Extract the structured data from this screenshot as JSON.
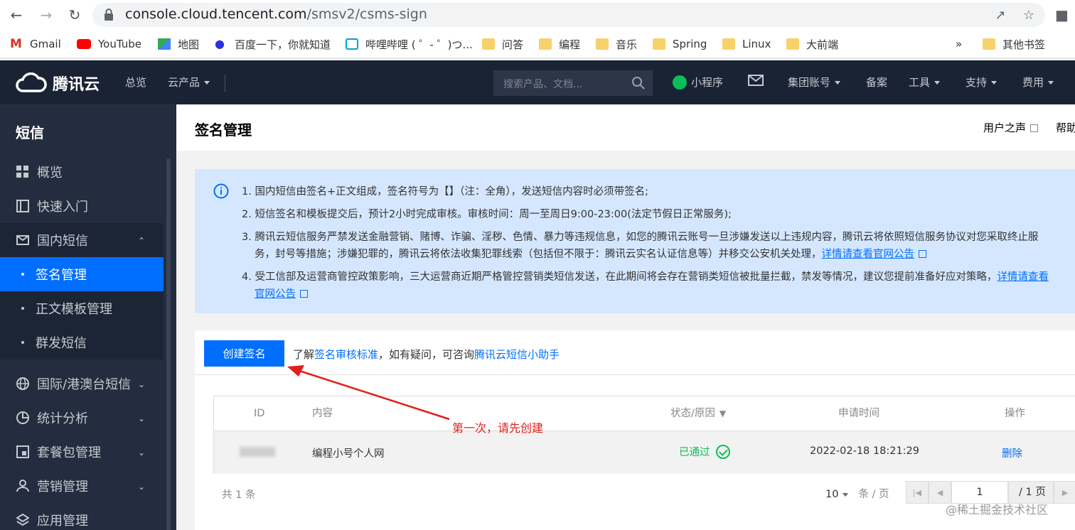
{
  "browser": {
    "url_host": "console.cloud.tencent.com",
    "url_path": "/smsv2/csms-sign",
    "bookmarks": [
      "Gmail",
      "YouTube",
      "地图",
      "百度一下，你就知道",
      "哔哩哔哩 ( ゜- ゜)つ...",
      "问答",
      "编程",
      "音乐",
      "Spring",
      "Linux",
      "大前端"
    ],
    "more": "»",
    "other_bookmarks": "其他书签"
  },
  "header": {
    "brand": "腾讯云",
    "nav_overview": "总览",
    "nav_products": "云产品",
    "search_placeholder": "搜索产品、文档...",
    "mini_program": "小程序",
    "group_account": "集团账号",
    "beian": "备案",
    "tools": "工具",
    "support": "支持",
    "fees": "费用"
  },
  "sidebar": {
    "title": "短信",
    "items": {
      "overview": "概览",
      "quickstart": "快速入门",
      "domestic": "国内短信",
      "sign_mgmt": "签名管理",
      "template_mgmt": "正文模板管理",
      "group_sms": "群发短信",
      "intl": "国际/港澳台短信",
      "stats": "统计分析",
      "package": "套餐包管理",
      "marketing": "营销管理",
      "app": "应用管理"
    }
  },
  "page": {
    "title": "签名管理",
    "user_voice": "用户之声",
    "help": "帮助"
  },
  "notice": {
    "l1": "1. 国内短信由签名+正文组成，签名符号为【】（注：全角），发送短信内容时必须带签名;",
    "l2": "2. 短信签名和模板提交后，预计2小时完成审核。审核时间：周一至周日9:00-23:00(法定节假日正常服务);",
    "l3a": "3. 腾讯云短信服务严禁发送金融营销、赌博、诈骗、淫秽、色情、暴力等违规信息，如您的腾讯云账号一旦涉嫌发送以上违规内容，腾讯云将依照短信服务协议对您采取终止服",
    "l3b": "务，封号等措施；涉嫌犯罪的，腾讯云将依法收集犯罪线索（包括但不限于：腾讯云实名认证信息等）并移交公安机关处理，",
    "l3_link": "详情请查看官网公告",
    "l4a": "4. 受工信部及运营商管控政策影响，三大运营商近期严格管控营销类短信发送，在此期间将会存在营销类短信被批量拦截，禁发等情况，建议您提前准备好应对策略，",
    "l4_link_a": "详情请查看",
    "l4_link_b": "官网公告"
  },
  "toolbar": {
    "create_label": "创建签名",
    "tip_prefix": "了解",
    "tip_link1": "签名审核标准",
    "tip_mid": "，如有疑问，可咨询",
    "tip_link2": "腾讯云短信小助手"
  },
  "table": {
    "headers": {
      "id": "ID",
      "content": "内容",
      "status": "状态/原因",
      "time": "申请时间",
      "ops": "操作"
    },
    "rows": [
      {
        "content": "编程小号个人网",
        "status": "已通过",
        "time": "2022-02-18 18:21:29",
        "action": "删除"
      }
    ]
  },
  "pager": {
    "total": "共 1 条",
    "page_size": "10",
    "size_unit": "条 / 页",
    "current": "1",
    "pages": "/ 1 页"
  },
  "annotation": "第一次，请先创建",
  "watermark": "@稀土掘金技术社区",
  "colors": {
    "accent": "#006eff",
    "success": "#0abf5b",
    "annotation": "#e0201c",
    "header_bg": "#1a2334",
    "sidebar_bg": "#232d3f"
  }
}
